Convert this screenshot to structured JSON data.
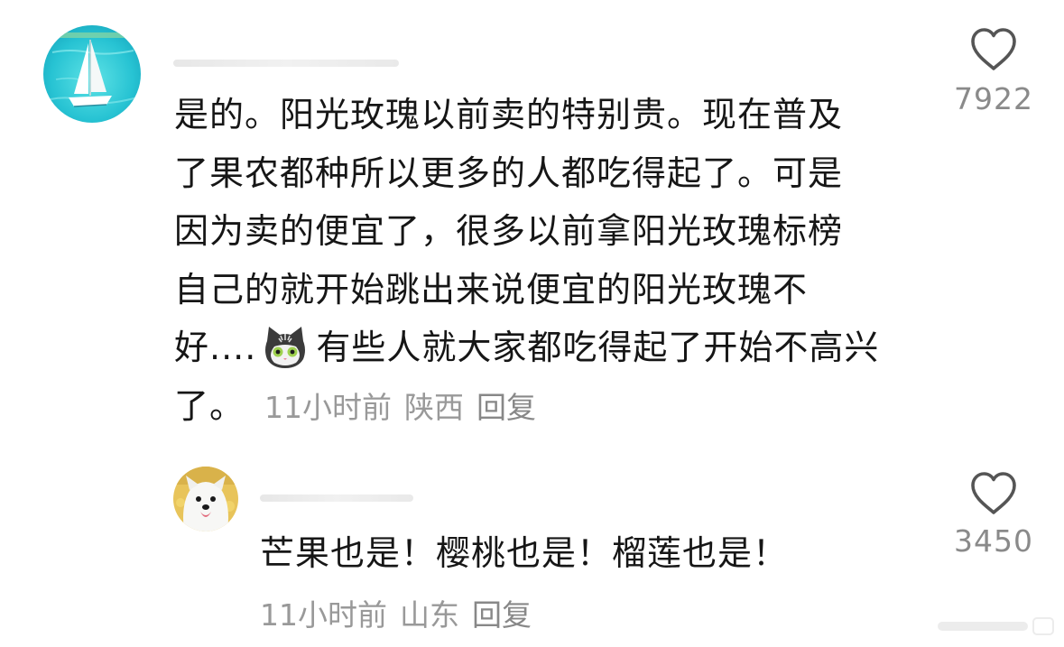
{
  "comment": {
    "avatar_icon": "sailboat-avatar-icon",
    "lines": [
      "是的。阳光玫瑰以前卖的特别贵。现在普及",
      "了果农都种所以更多的人都吃得起了。可是",
      "因为卖的便宜了，很多以前拿阳光玫瑰标榜",
      "自己的就开始跳出来说便宜的阳光玫瑰不"
    ],
    "line5_prefix": "好....",
    "emoji_icon": "cat-face-emoji-icon",
    "line5_suffix": "有些人就大家都吃得起了开始不高兴",
    "line6": "了。",
    "time": "11小时前",
    "location": "陕西",
    "reply_label": "回复",
    "likes": "7922"
  },
  "reply": {
    "avatar_icon": "dog-avatar-icon",
    "text": "芒果也是！樱桃也是！榴莲也是！",
    "time": "11小时前",
    "location": "山东",
    "reply_label": "回复",
    "likes": "3450"
  },
  "colors": {
    "text": "#161616",
    "meta": "#999999",
    "count": "#8a8a8a",
    "heart_stroke": "#555555"
  }
}
